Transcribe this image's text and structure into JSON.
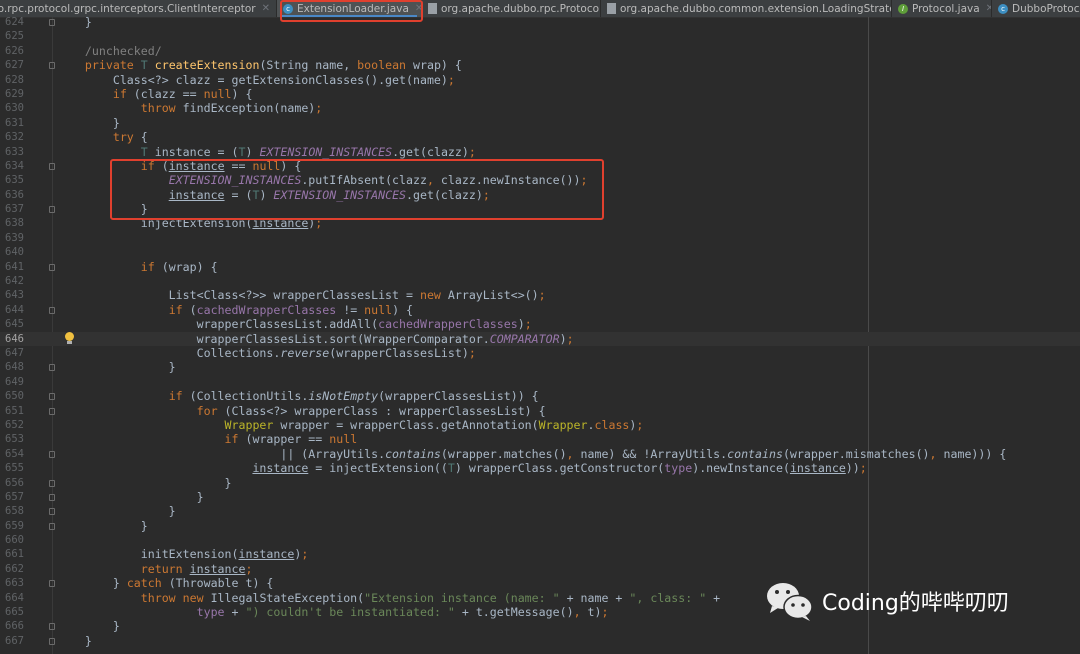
{
  "tabs": [
    {
      "label": "ne.dubbo.rpc.protocol.grpc.interceptors.ClientInterceptor",
      "icon": "file-icon",
      "active": false
    },
    {
      "label": "ExtensionLoader.java",
      "icon": "class-icon",
      "active": true
    },
    {
      "label": "org.apache.dubbo.rpc.Protocol",
      "icon": "file-icon",
      "active": false
    },
    {
      "label": "org.apache.dubbo.common.extension.LoadingStrategy",
      "icon": "file-icon",
      "active": false
    },
    {
      "label": "Protocol.java",
      "icon": "interface-icon",
      "active": false
    },
    {
      "label": "DubboProtocol",
      "icon": "class-icon",
      "active": false
    }
  ],
  "current_line": 646,
  "colors": {
    "highlight_box": "#e0402e",
    "keyword": "#cc7832",
    "static_field": "#9876aa",
    "string": "#6a8759",
    "method_decl": "#ffc66d"
  },
  "lines": [
    {
      "n": 624,
      "t": [
        [
          "p",
          "    }"
        ]
      ]
    },
    {
      "n": 625,
      "t": []
    },
    {
      "n": 626,
      "t": [
        [
          "p",
          "    "
        ],
        [
          "c",
          "/unchecked/"
        ]
      ]
    },
    {
      "n": 627,
      "t": [
        [
          "p",
          "    "
        ],
        [
          "k",
          "private "
        ],
        [
          "t",
          "T "
        ],
        [
          "m",
          "createExtension"
        ],
        [
          "p",
          "(String name, "
        ],
        [
          "k",
          "boolean "
        ],
        [
          "p",
          "wrap) {"
        ]
      ]
    },
    {
      "n": 628,
      "t": [
        [
          "p",
          "        Class<?> clazz = getExtensionClasses().get(name)"
        ],
        [
          "k",
          ";"
        ]
      ]
    },
    {
      "n": 629,
      "t": [
        [
          "p",
          "        "
        ],
        [
          "k",
          "if "
        ],
        [
          "p",
          "(clazz == "
        ],
        [
          "k",
          "null"
        ],
        [
          "p",
          ") {"
        ]
      ]
    },
    {
      "n": 630,
      "t": [
        [
          "p",
          "            "
        ],
        [
          "k",
          "throw "
        ],
        [
          "p",
          "findException(name)"
        ],
        [
          "k",
          ";"
        ]
      ]
    },
    {
      "n": 631,
      "t": [
        [
          "p",
          "        }"
        ]
      ]
    },
    {
      "n": 632,
      "t": [
        [
          "p",
          "        "
        ],
        [
          "k",
          "try "
        ],
        [
          "p",
          "{"
        ]
      ]
    },
    {
      "n": 633,
      "t": [
        [
          "p",
          "            "
        ],
        [
          "t",
          "T "
        ],
        [
          "p",
          "instance = ("
        ],
        [
          "t",
          "T"
        ],
        [
          "p",
          ") "
        ],
        [
          "s",
          "EXTENSION_INSTANCES"
        ],
        [
          "p",
          ".get(clazz)"
        ],
        [
          "k",
          ";"
        ]
      ]
    },
    {
      "n": 634,
      "t": [
        [
          "p",
          "            "
        ],
        [
          "k",
          "if "
        ],
        [
          "p",
          "("
        ],
        [
          "u",
          "instance"
        ],
        [
          "p",
          " == "
        ],
        [
          "k",
          "null"
        ],
        [
          "p",
          ") {"
        ]
      ]
    },
    {
      "n": 635,
      "t": [
        [
          "p",
          "                "
        ],
        [
          "s",
          "EXTENSION_INSTANCES"
        ],
        [
          "p",
          ".putIfAbsent(clazz"
        ],
        [
          "k",
          ", "
        ],
        [
          "p",
          "clazz.newInstance())"
        ],
        [
          "k",
          ";"
        ]
      ]
    },
    {
      "n": 636,
      "t": [
        [
          "p",
          "                "
        ],
        [
          "u",
          "instance"
        ],
        [
          "p",
          " = ("
        ],
        [
          "t",
          "T"
        ],
        [
          "p",
          ") "
        ],
        [
          "s",
          "EXTENSION_INSTANCES"
        ],
        [
          "p",
          ".get(clazz)"
        ],
        [
          "k",
          ";"
        ]
      ]
    },
    {
      "n": 637,
      "t": [
        [
          "p",
          "            }"
        ]
      ]
    },
    {
      "n": 638,
      "t": [
        [
          "p",
          "            injectExtension("
        ],
        [
          "u",
          "instance"
        ],
        [
          "p",
          ")"
        ],
        [
          "k",
          ";"
        ]
      ]
    },
    {
      "n": 639,
      "t": []
    },
    {
      "n": 640,
      "t": []
    },
    {
      "n": 641,
      "t": [
        [
          "p",
          "            "
        ],
        [
          "k",
          "if "
        ],
        [
          "p",
          "(wrap) {"
        ]
      ]
    },
    {
      "n": 642,
      "t": []
    },
    {
      "n": 643,
      "t": [
        [
          "p",
          "                List<Class<?>> wrapperClassesList = "
        ],
        [
          "k",
          "new "
        ],
        [
          "p",
          "ArrayList<>()"
        ],
        [
          "k",
          ";"
        ]
      ]
    },
    {
      "n": 644,
      "t": [
        [
          "p",
          "                "
        ],
        [
          "k",
          "if "
        ],
        [
          "p",
          "("
        ],
        [
          "f",
          "cachedWrapperClasses"
        ],
        [
          "p",
          " != "
        ],
        [
          "k",
          "null"
        ],
        [
          "p",
          ") {"
        ]
      ]
    },
    {
      "n": 645,
      "t": [
        [
          "p",
          "                    wrapperClassesList.addAll("
        ],
        [
          "f",
          "cachedWrapperClasses"
        ],
        [
          "p",
          ")"
        ],
        [
          "k",
          ";"
        ]
      ]
    },
    {
      "n": 646,
      "t": [
        [
          "p",
          "                    wrapperClassesList.sort(WrapperComparator."
        ],
        [
          "s",
          "COMPARATOR"
        ],
        [
          "p",
          ")"
        ],
        [
          "k",
          ";"
        ]
      ]
    },
    {
      "n": 647,
      "t": [
        [
          "p",
          "                    Collections."
        ],
        [
          "i",
          "reverse"
        ],
        [
          "p",
          "(wrapperClassesList)"
        ],
        [
          "k",
          ";"
        ]
      ]
    },
    {
      "n": 648,
      "t": [
        [
          "p",
          "                }"
        ]
      ]
    },
    {
      "n": 649,
      "t": []
    },
    {
      "n": 650,
      "t": [
        [
          "p",
          "                "
        ],
        [
          "k",
          "if "
        ],
        [
          "p",
          "(CollectionUtils."
        ],
        [
          "i",
          "isNotEmpty"
        ],
        [
          "p",
          "(wrapperClassesList)) {"
        ]
      ]
    },
    {
      "n": 651,
      "t": [
        [
          "p",
          "                    "
        ],
        [
          "k",
          "for "
        ],
        [
          "p",
          "(Class<?> wrapperClass : wrapperClassesList) {"
        ]
      ]
    },
    {
      "n": 652,
      "t": [
        [
          "p",
          "                        "
        ],
        [
          "a",
          "Wrapper "
        ],
        [
          "p",
          "wrapper = wrapperClass.getAnnotation("
        ],
        [
          "a",
          "Wrapper"
        ],
        [
          "p",
          "."
        ],
        [
          "k",
          "class"
        ],
        [
          "p",
          ")"
        ],
        [
          "k",
          ";"
        ]
      ]
    },
    {
      "n": 653,
      "t": [
        [
          "p",
          "                        "
        ],
        [
          "k",
          "if "
        ],
        [
          "p",
          "(wrapper == "
        ],
        [
          "k",
          "null"
        ]
      ]
    },
    {
      "n": 654,
      "t": [
        [
          "p",
          "                                || (ArrayUtils."
        ],
        [
          "i",
          "contains"
        ],
        [
          "p",
          "(wrapper.matches()"
        ],
        [
          "k",
          ", "
        ],
        [
          "p",
          "name) && !ArrayUtils."
        ],
        [
          "i",
          "contains"
        ],
        [
          "p",
          "(wrapper.mismatches()"
        ],
        [
          "k",
          ", "
        ],
        [
          "p",
          "name))) {"
        ]
      ]
    },
    {
      "n": 655,
      "t": [
        [
          "p",
          "                            "
        ],
        [
          "u",
          "instance"
        ],
        [
          "p",
          " = injectExtension(("
        ],
        [
          "t",
          "T"
        ],
        [
          "p",
          ") wrapperClass.getConstructor("
        ],
        [
          "f",
          "type"
        ],
        [
          "p",
          ").newInstance("
        ],
        [
          "u",
          "instance"
        ],
        [
          "p",
          "))"
        ],
        [
          "k",
          ";"
        ]
      ]
    },
    {
      "n": 656,
      "t": [
        [
          "p",
          "                        }"
        ]
      ]
    },
    {
      "n": 657,
      "t": [
        [
          "p",
          "                    }"
        ]
      ]
    },
    {
      "n": 658,
      "t": [
        [
          "p",
          "                }"
        ]
      ]
    },
    {
      "n": 659,
      "t": [
        [
          "p",
          "            }"
        ]
      ]
    },
    {
      "n": 660,
      "t": []
    },
    {
      "n": 661,
      "t": [
        [
          "p",
          "            initExtension("
        ],
        [
          "u",
          "instance"
        ],
        [
          "p",
          ")"
        ],
        [
          "k",
          ";"
        ]
      ]
    },
    {
      "n": 662,
      "t": [
        [
          "p",
          "            "
        ],
        [
          "k",
          "return "
        ],
        [
          "u",
          "instance"
        ],
        [
          "k",
          ";"
        ]
      ]
    },
    {
      "n": 663,
      "t": [
        [
          "p",
          "        } "
        ],
        [
          "k",
          "catch "
        ],
        [
          "p",
          "(Throwable t) {"
        ]
      ]
    },
    {
      "n": 664,
      "t": [
        [
          "p",
          "            "
        ],
        [
          "k",
          "throw new "
        ],
        [
          "p",
          "IllegalStateException("
        ],
        [
          "str",
          "\"Extension instance (name: \""
        ],
        [
          "p",
          " + name + "
        ],
        [
          "str",
          "\", class: \""
        ],
        [
          "p",
          " +"
        ]
      ]
    },
    {
      "n": 665,
      "t": [
        [
          "p",
          "                    "
        ],
        [
          "f",
          "type"
        ],
        [
          "p",
          " + "
        ],
        [
          "str",
          "\") couldn't be instantiated: \""
        ],
        [
          "p",
          " + t.getMessage()"
        ],
        [
          "k",
          ", "
        ],
        [
          "p",
          "t)"
        ],
        [
          "k",
          ";"
        ]
      ]
    },
    {
      "n": 666,
      "t": [
        [
          "p",
          "        }"
        ]
      ]
    },
    {
      "n": 667,
      "t": [
        [
          "p",
          "    }"
        ]
      ]
    }
  ],
  "fold_lines": [
    624,
    627,
    634,
    637,
    641,
    644,
    648,
    650,
    651,
    654,
    656,
    657,
    658,
    659,
    663,
    666,
    667
  ],
  "watermark": {
    "text": "Coding的哔哔叨叨",
    "icon": "wechat-icon"
  }
}
